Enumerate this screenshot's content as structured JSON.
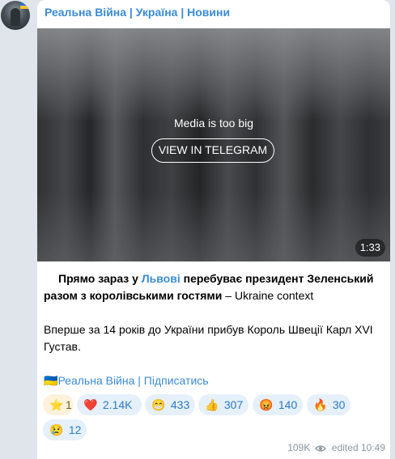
{
  "channel": {
    "name": "Реальна Війна | Україна | Новини"
  },
  "media": {
    "notice": "Media is too big",
    "button_label": "VIEW IN TELEGRAM",
    "duration": "1:33"
  },
  "post": {
    "p1_before": "Прямо зараз у ",
    "p1_link": "Львові",
    "p1_bold_after": " перебуває президент Зеленський разом з королівськими гостями",
    "p1_tail": " – Ukraine context",
    "p2": "Вперше за 14 років до України прибув Король Швеції Карл XVI Густав.",
    "subscribe_flag": "🇺🇦",
    "subscribe_link": "Реальна Війна | Підписатись"
  },
  "reactions": [
    {
      "emoji": "⭐",
      "count": "1",
      "icon": "star-icon"
    },
    {
      "emoji": "❤️",
      "count": "2.14K",
      "icon": "heart-icon"
    },
    {
      "emoji": "😁",
      "count": "433",
      "icon": "grin-icon"
    },
    {
      "emoji": "👍",
      "count": "307",
      "icon": "thumbs-up-icon"
    },
    {
      "emoji": "😡",
      "count": "140",
      "icon": "angry-face-icon"
    },
    {
      "emoji": "🔥",
      "count": "30",
      "icon": "fire-icon"
    },
    {
      "emoji": "😢",
      "count": "12",
      "icon": "crying-face-icon"
    }
  ],
  "meta": {
    "views": "109K",
    "edited_label": "edited",
    "time": "10:49"
  },
  "colors": {
    "link": "#3a8bd6",
    "reaction_bg": "#e6f0fa",
    "page_bg": "#dfe5ea"
  }
}
